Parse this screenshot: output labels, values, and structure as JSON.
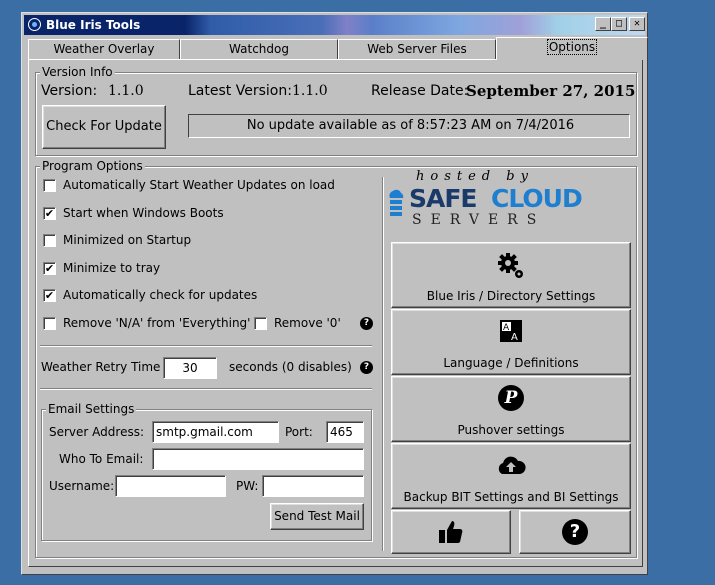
{
  "window": {
    "title": "Blue Iris Tools"
  },
  "titlebar_buttons": {
    "minimize": "_",
    "maximize": "□",
    "close": "✕"
  },
  "tabs": [
    {
      "label": "Weather Overlay"
    },
    {
      "label": "Watchdog"
    },
    {
      "label": "Web Server Files"
    },
    {
      "label": "Options",
      "active": true
    }
  ],
  "version_info": {
    "legend": "Version Info",
    "version_label": "Version:",
    "version_value": "1.1.0",
    "latest_label": "Latest Version:",
    "latest_value": "1.1.0",
    "release_label": "Release Date:",
    "release_value": "September 27, 2015",
    "check_button": "Check For Update",
    "status": "No update available as of 8:57:23 AM on 7/4/2016"
  },
  "program_options": {
    "legend": "Program Options",
    "checkboxes": [
      {
        "label": "Automatically Start Weather Updates on load",
        "checked": false
      },
      {
        "label": "Start when Windows Boots",
        "checked": true
      },
      {
        "label": "Minimized on Startup",
        "checked": false
      },
      {
        "label": "Minimize to tray",
        "checked": true
      },
      {
        "label": "Automatically check for updates",
        "checked": true
      }
    ],
    "remove_na_label": "Remove 'N/A' from 'Everything'",
    "remove_na_checked": false,
    "remove_zero_label": "Remove '0'",
    "remove_zero_checked": false,
    "retry_label": "Weather Retry Time",
    "retry_value": "30",
    "retry_suffix": "seconds (0 disables)",
    "check_mark": "✔",
    "help_glyph": "?"
  },
  "email": {
    "legend": "Email Settings",
    "server_label": "Server Address:",
    "server_value": "smtp.gmail.com",
    "port_label": "Port:",
    "port_value": "465",
    "who_label": "Who To Email:",
    "who_value": "",
    "username_label": "Username:",
    "username_value": "",
    "pw_label": "PW:",
    "pw_value": "",
    "send_button": "Send Test Mail"
  },
  "sponsor": {
    "hosted_by": "hosted by",
    "brand_safe": "SAFE",
    "brand_cloud": "CLOUD",
    "brand_servers": "SERVERS"
  },
  "side_buttons": [
    {
      "label": "Blue Iris / Directory Settings",
      "icon": "gears-icon"
    },
    {
      "label": "Language / Definitions",
      "icon": "translate-icon"
    },
    {
      "label": "Pushover settings",
      "icon": "pushover-icon"
    },
    {
      "label": "Backup BIT Settings and BI Settings",
      "icon": "cloud-upload-icon"
    }
  ],
  "bottom_buttons": {
    "like_icon": "thumbs-up-icon",
    "help_icon": "help-icon",
    "help_glyph": "?",
    "pushover_glyph": "P"
  },
  "colors": {
    "desktop": "#3a6ea5",
    "titlebar": "#0a246a",
    "brand": "#1e7fd0",
    "face": "#c0c0c0"
  }
}
